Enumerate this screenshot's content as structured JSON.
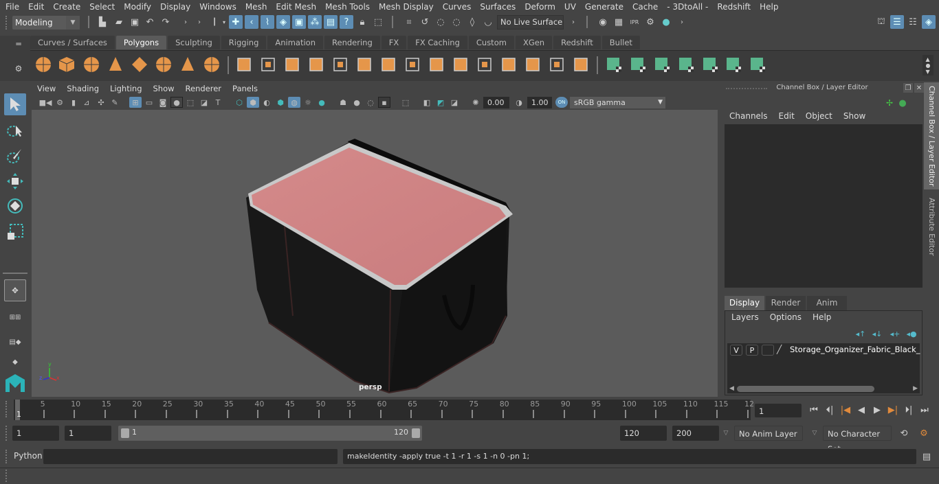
{
  "menubar": [
    "File",
    "Edit",
    "Create",
    "Select",
    "Modify",
    "Display",
    "Windows",
    "Mesh",
    "Edit Mesh",
    "Mesh Tools",
    "Mesh Display",
    "Curves",
    "Surfaces",
    "Deform",
    "UV",
    "Generate",
    "Cache",
    "- 3DtoAll -",
    "Redshift",
    "Help"
  ],
  "status_line": {
    "mode": "Modeling",
    "live_surface": "No Live Surface"
  },
  "shelf": {
    "tabs": [
      "Curves / Surfaces",
      "Polygons",
      "Sculpting",
      "Rigging",
      "Animation",
      "Rendering",
      "FX",
      "FX Caching",
      "Custom",
      "XGen",
      "Redshift",
      "Bullet"
    ],
    "active_tab": "Polygons",
    "icons": [
      "poly-sphere",
      "poly-cube",
      "poly-cylinder",
      "poly-cone",
      "poly-plane",
      "poly-torus",
      "poly-pyramid",
      "poly-pipe",
      "combine",
      "separate",
      "mirror",
      "smooth",
      "extract",
      "bevel",
      "multi-cut",
      "extrude",
      "bridge",
      "append-polygon",
      "insert-edge-loop",
      "offset-edge-loop",
      "split",
      "target-weld",
      "unfold",
      "automatic-uv",
      "planar-uv",
      "cylindrical-uv",
      "cut-uv",
      "uv-transfer",
      "uv-editor",
      "layout-uv"
    ]
  },
  "viewport": {
    "menus": [
      "View",
      "Shading",
      "Lighting",
      "Show",
      "Renderer",
      "Panels"
    ],
    "exposure": "0.00",
    "gamma": "1.00",
    "color_management": "sRGB gamma",
    "camera_label": "persp",
    "axis": {
      "x": "x",
      "y": "y",
      "z": "z"
    }
  },
  "channel_box": {
    "title": "Channel Box / Layer Editor",
    "menus": [
      "Channels",
      "Edit",
      "Object",
      "Show"
    ]
  },
  "layer_editor": {
    "tabs": [
      "Display",
      "Render",
      "Anim"
    ],
    "active_tab": "Display",
    "menus": [
      "Layers",
      "Options",
      "Help"
    ],
    "layers": [
      {
        "v": "V",
        "p": "P",
        "name": "Storage_Organizer_Fabric_Black_Ope"
      }
    ]
  },
  "side_tabs": [
    "Channel Box / Layer Editor",
    "Attribute Editor"
  ],
  "timeline": {
    "ticks": [
      "5",
      "10",
      "15",
      "20",
      "25",
      "30",
      "35",
      "40",
      "45",
      "50",
      "55",
      "60",
      "65",
      "70",
      "75",
      "80",
      "85",
      "90",
      "95",
      "100",
      "105",
      "110",
      "115",
      "12"
    ],
    "current_frame_marker": "1",
    "current_frame": "1"
  },
  "range": {
    "start": "1",
    "playback_start": "1",
    "slider_start": "1",
    "slider_end": "120",
    "playback_end": "120",
    "end": "200",
    "anim_layer": "No Anim Layer",
    "character_set": "No Character Set"
  },
  "command_line": {
    "language": "Python",
    "input": "",
    "output": "makeIdentity -apply true -t 1 -r 1 -s 1 -n 0 -pn 1;"
  }
}
